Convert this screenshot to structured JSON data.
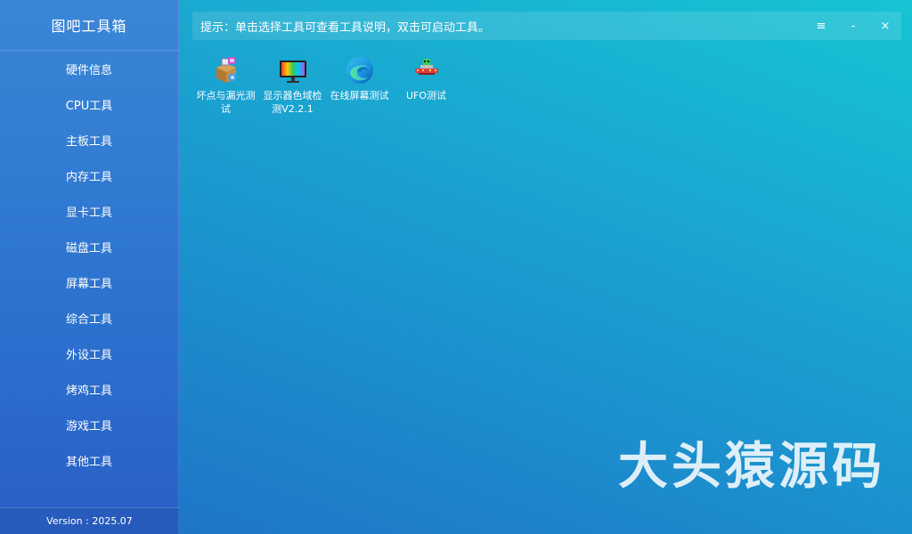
{
  "app": {
    "title": "图吧工具箱",
    "version": "Version : 2025.07"
  },
  "sidebar": {
    "items": [
      {
        "label": "硬件信息"
      },
      {
        "label": "CPU工具"
      },
      {
        "label": "主板工具"
      },
      {
        "label": "内存工具"
      },
      {
        "label": "显卡工具"
      },
      {
        "label": "磁盘工具"
      },
      {
        "label": "屏幕工具"
      },
      {
        "label": "综合工具"
      },
      {
        "label": "外设工具"
      },
      {
        "label": "烤鸡工具"
      },
      {
        "label": "游戏工具"
      },
      {
        "label": "其他工具"
      }
    ]
  },
  "topbar": {
    "hint": "提示：单击选择工具可查看工具说明，双击可启动工具。",
    "menu_glyph": "≡",
    "minimize_glyph": "-",
    "close_glyph": "×"
  },
  "tools": [
    {
      "label": "坏点与漏光测试",
      "icon": "box-package-icon"
    },
    {
      "label": "显示器色域检测V2.2.1",
      "icon": "monitor-color-icon"
    },
    {
      "label": "在线屏幕测试",
      "icon": "edge-browser-icon"
    },
    {
      "label": "UFO测试",
      "icon": "ufo-icon"
    }
  ],
  "watermark": "大头猿源码",
  "colors": {
    "sidebar": "#2f78d2",
    "accent": "#17b8d4"
  }
}
